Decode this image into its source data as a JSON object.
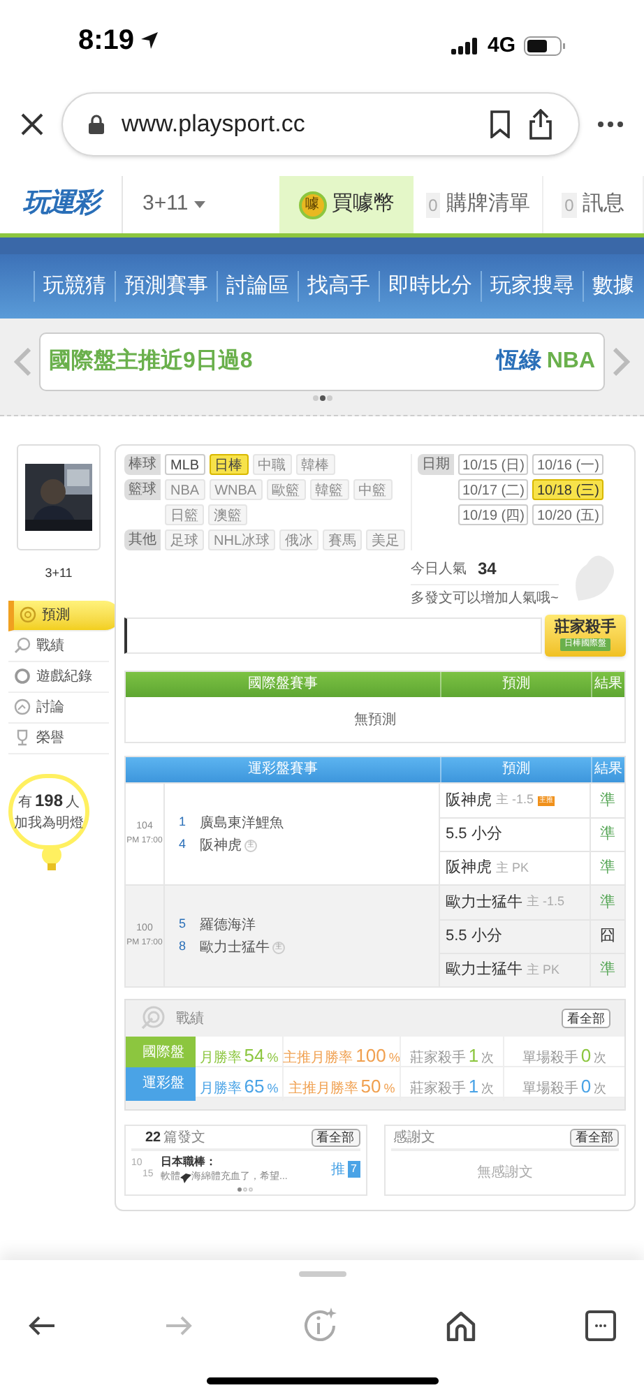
{
  "status_bar": {
    "time": "8:19",
    "network": "4G"
  },
  "browser": {
    "url": "www.playsport.cc"
  },
  "site_header": {
    "logo": "玩運彩",
    "user": "3+11",
    "buy_coins": "買噱幣",
    "coin_icon": "噱",
    "cart": {
      "count": "0",
      "label": "購牌清單"
    },
    "messages": {
      "count": "0",
      "label": "訊息"
    }
  },
  "nav": [
    "玩競猜",
    "預測賽事",
    "討論區",
    "找高手",
    "即時比分",
    "玩家搜尋",
    "數據"
  ],
  "ticker": {
    "left_text": "國際盤主推近9日過8",
    "right_name": "恆綠",
    "right_text": "NBA",
    "dots": [
      {
        "selected": false
      },
      {
        "selected": true
      },
      {
        "selected": false
      }
    ]
  },
  "profile": {
    "name": "3+11"
  },
  "side_menu": [
    {
      "label": "預測",
      "selected": true
    },
    {
      "label": "戰績",
      "selected": false
    },
    {
      "label": "遊戲紀錄",
      "selected": false
    },
    {
      "label": "討論",
      "selected": false
    },
    {
      "label": "榮譽",
      "selected": false
    }
  ],
  "fans": {
    "prefix": "有",
    "count": "198",
    "suffix": "人",
    "line2": "加我為明燈"
  },
  "filters": {
    "groups": [
      {
        "label": "棒球",
        "tags": [
          {
            "label": "MLB",
            "selected": false,
            "disabled": false
          },
          {
            "label": "日棒",
            "selected": true,
            "disabled": false
          },
          {
            "label": "中職",
            "selected": false,
            "disabled": true
          },
          {
            "label": "韓棒",
            "selected": false,
            "disabled": true
          }
        ]
      },
      {
        "label": "籃球",
        "tags": [
          {
            "label": "NBA",
            "selected": false,
            "disabled": true
          },
          {
            "label": "WNBA",
            "selected": false,
            "disabled": true
          },
          {
            "label": "歐籃",
            "selected": false,
            "disabled": true
          },
          {
            "label": "韓籃",
            "selected": false,
            "disabled": true
          },
          {
            "label": "中籃",
            "selected": false,
            "disabled": true
          },
          {
            "label": "日籃",
            "selected": false,
            "disabled": true
          },
          {
            "label": "澳籃",
            "selected": false,
            "disabled": true
          }
        ]
      },
      {
        "label": "其他",
        "tags": [
          {
            "label": "足球",
            "selected": false,
            "disabled": true
          },
          {
            "label": "NHL冰球",
            "selected": false,
            "disabled": true
          },
          {
            "label": "俄冰",
            "selected": false,
            "disabled": true
          },
          {
            "label": "賽馬",
            "selected": false,
            "disabled": true
          },
          {
            "label": "美足",
            "selected": false,
            "disabled": true
          }
        ]
      }
    ],
    "date_label": "日期",
    "dates": [
      {
        "label": "10/15 (日)",
        "selected": false
      },
      {
        "label": "10/16 (一)",
        "selected": false
      },
      {
        "label": "10/17 (二)",
        "selected": false
      },
      {
        "label": "10/18 (三)",
        "selected": true
      },
      {
        "label": "10/19 (四)",
        "selected": false
      },
      {
        "label": "10/20 (五)",
        "selected": false
      }
    ]
  },
  "popularity": {
    "label": "今日人氣",
    "value": "34",
    "hint": "多發文可以增加人氣哦~"
  },
  "badge": {
    "title": "莊家殺手",
    "subtitle": "日棒國際盤"
  },
  "intl_table": {
    "columns": [
      "國際盤賽事",
      "預測",
      "結果"
    ],
    "empty": "無預測"
  },
  "lottery_table": {
    "columns": [
      "運彩盤賽事",
      "預測",
      "結果"
    ],
    "games": [
      {
        "no": "104",
        "time": "PM 17:00",
        "teams": [
          {
            "num": "1",
            "name": "廣島東洋鯉魚"
          },
          {
            "num": "4",
            "name": "阪神虎",
            "mark": "主"
          }
        ],
        "picks": [
          {
            "team": "阪神虎",
            "detail": "主 -1.5",
            "tag": "主推",
            "result": "準",
            "hit": true
          },
          {
            "team": "5.5 小分",
            "result": "準",
            "hit": true
          },
          {
            "team": "阪神虎",
            "detail": "主 PK",
            "result": "準",
            "hit": true
          }
        ]
      },
      {
        "no": "100",
        "time": "PM 17:00",
        "teams": [
          {
            "num": "5",
            "name": "羅德海洋"
          },
          {
            "num": "8",
            "name": "歐力士猛牛",
            "mark": "主"
          }
        ],
        "picks": [
          {
            "team": "歐力士猛牛",
            "detail": "主 -1.5",
            "result": "準",
            "hit": true
          },
          {
            "team": "5.5 小分",
            "result": "囧",
            "hit": false
          },
          {
            "team": "歐力士猛牛",
            "detail": "主 PK",
            "result": "準",
            "hit": true
          }
        ]
      }
    ]
  },
  "record": {
    "title": "戰績",
    "button": "看全部",
    "rows": [
      {
        "label": "國際盤",
        "color": "#8cc63f",
        "cells": [
          {
            "label": "月勝率",
            "value": "54",
            "unit": "%"
          },
          {
            "label": "主推月勝率",
            "value": "100",
            "unit": "%"
          },
          {
            "label": "莊家殺手",
            "value": "1",
            "unit": "次"
          },
          {
            "label": "單場殺手",
            "value": "0",
            "unit": "次"
          }
        ]
      },
      {
        "label": "運彩盤",
        "color": "#4aa3e6",
        "cells": [
          {
            "label": "月勝率",
            "value": "65",
            "unit": "%"
          },
          {
            "label": "主推月勝率",
            "value": "50",
            "unit": "%"
          },
          {
            "label": "莊家殺手",
            "value": "1",
            "unit": "次"
          },
          {
            "label": "單場殺手",
            "value": "0",
            "unit": "次"
          }
        ]
      }
    ]
  },
  "posts": {
    "count": "22",
    "label": "篇發文",
    "button": "看全部",
    "item": {
      "day": "10",
      "month": "15",
      "title": "日本職棒：",
      "excerpt_before": "軟體",
      "excerpt_after": "海綿體充血了，希望...",
      "tag": "推",
      "likes": "7"
    },
    "dots": [
      {
        "selected": true
      },
      {
        "selected": false
      },
      {
        "selected": false
      }
    ]
  },
  "thanks": {
    "title": "感謝文",
    "button": "看全部",
    "empty": "無感謝文"
  }
}
